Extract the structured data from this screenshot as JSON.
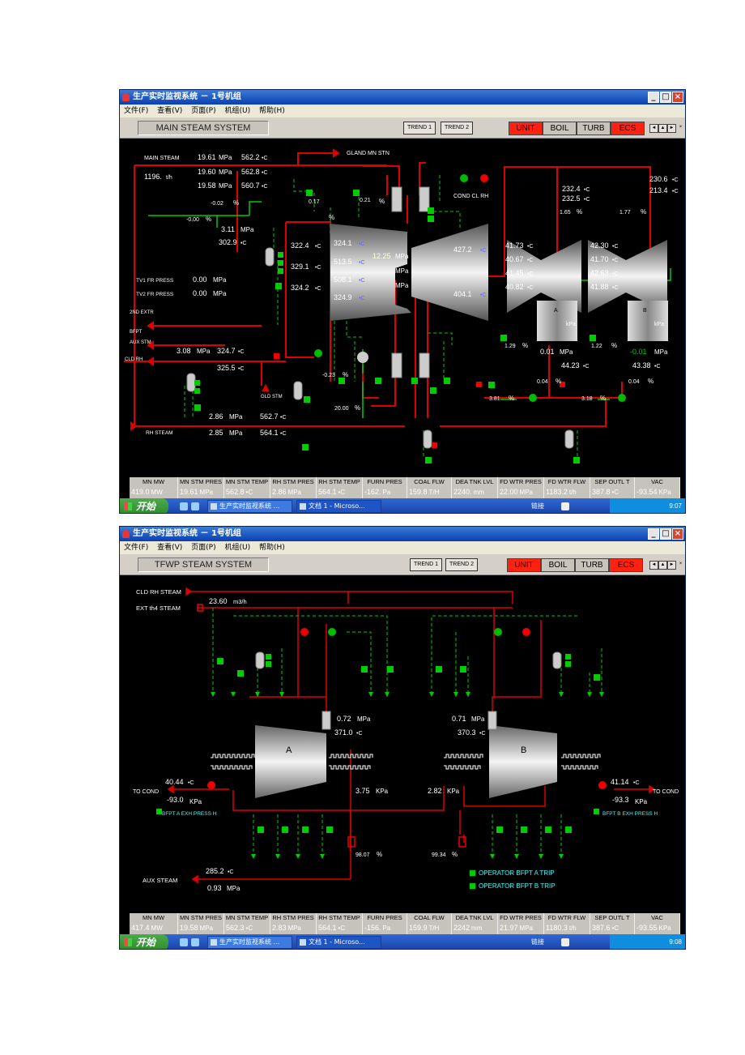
{
  "windows": [
    {
      "title": "生产实时监视系统 － 1号机组",
      "menu": [
        "文件(F)",
        "查看(V)",
        "页面(P)",
        "机组(U)",
        "帮助(H)"
      ],
      "screen_title": "MAIN STEAM SYSTEM",
      "trend_buttons": [
        "TREND 1",
        "TREND 2"
      ],
      "modes": [
        "UNIT",
        "BOIL",
        "TURB",
        "ECS"
      ],
      "labels": {
        "main_steam": "MAIN STEAM",
        "flow": "1196.",
        "flow_unit": "t/h",
        "gland": "GLAND MN STN",
        "cond_cl_rh": "COND  CL RH",
        "tv1": "TV1 FR PRESS",
        "tv2": "TV2 FR PRESS",
        "extr": "2ND EXTR",
        "bfpt": "BFPT",
        "aux_stm": "AUX STM",
        "cld_rh": "CLD RH",
        "gld_stm": "GLD STM",
        "rh_steam": "RH STEAM",
        "pump_a": "A",
        "pump_b": "B",
        "v1": "19.61",
        "v2": "562.2",
        "v3": "19.60",
        "v4": "562.8",
        "v5": "19.58",
        "v6": "560.7",
        "v7": "-0.02",
        "v8": "-0.00",
        "v9": "0.17",
        "v10": "0.21",
        "v11": "3.11",
        "v12": "302.9",
        "v13": "322.4",
        "v14": "329.1",
        "v15": "324.2",
        "v16": "324.1",
        "v17": "513.5",
        "v18": "508.1",
        "v19": "324.9",
        "v20": "12.25",
        "v21": "427.2",
        "v22": "404.1",
        "v23": "232.4",
        "v24": "232.5",
        "v25": "1.65",
        "v26": "1.77",
        "v27": "230.6",
        "v28": "213.4",
        "v29": "41.73",
        "v30": "40.67",
        "v31": "41.45",
        "v32": "40.82",
        "v33": "42.30",
        "v34": "41.70",
        "v35": "42.63",
        "v36": "41.88",
        "v37": "0.00",
        "v38": "0.00",
        "v39": "3.08",
        "v40": "324.7",
        "v41": "325.5",
        "v42": "-0.23",
        "v43": "20.00",
        "v44": "1.29",
        "v45": "0.01",
        "v46": "44.23",
        "v47": "0.04",
        "v48": "1.22",
        "v49": "-0.01",
        "v50": "43.38",
        "v51": "0.04",
        "v52": "3.81",
        "v53": "3.18",
        "v54": "2.86",
        "v55": "562.7",
        "v56": "2.85",
        "v57": "564.1",
        "unit_mpa": "MPa",
        "unit_c": "•C",
        "unit_pct": "%",
        "unit_kpa": "kPa"
      },
      "status": [
        {
          "h": "MN MW",
          "v": "419.0",
          "u": "MW"
        },
        {
          "h": "MN STM PRES",
          "v": "19.61",
          "u": "MPa"
        },
        {
          "h": "MN STM TEMP",
          "v": "562.8",
          "u": "•C"
        },
        {
          "h": "RH STM PRES",
          "v": "2.86",
          "u": "MPa"
        },
        {
          "h": "RH STM TEMP",
          "v": "564.1",
          "u": "•C"
        },
        {
          "h": "FURN PRES",
          "v": "-162.",
          "u": "Pa"
        },
        {
          "h": "COAL FLW",
          "v": "159.8",
          "u": "T/H"
        },
        {
          "h": "DEA TNK LVL",
          "v": "2240.",
          "u": "mm"
        },
        {
          "h": "FD WTR PRES",
          "v": "22.00",
          "u": "MPa"
        },
        {
          "h": "FD WTR FLW",
          "v": "1183.2",
          "u": "t/h"
        },
        {
          "h": "SEP OUTL T",
          "v": "387.8",
          "u": "•C"
        },
        {
          "h": "VAC",
          "v": "-93.54",
          "u": "KPa"
        }
      ],
      "taskbar": {
        "start": "开始",
        "tasks": [
          "生产实时监视系统 ...",
          "文档 1 - Microso..."
        ],
        "link": "链接",
        "clock": "9:07"
      }
    },
    {
      "title": "生产实时监视系统 － 1号机组",
      "menu": [
        "文件(F)",
        "查看(V)",
        "页面(P)",
        "机组(U)",
        "帮助(H)"
      ],
      "screen_title": "TFWP STEAM SYSTEM",
      "trend_buttons": [
        "TREND 1",
        "TREND 2"
      ],
      "modes": [
        "UNIT",
        "BOIL",
        "TURB",
        "ECS"
      ],
      "labels": {
        "cld_rh_steam": "CLD RH STEAM",
        "ext_steam": "EXT th4 STEAM",
        "flow": "23.60",
        "flow_unit": "m3/h",
        "turbine_a": "A",
        "turbine_b": "B",
        "a_press": "0.72",
        "a_temp": "371.0",
        "b_press": "0.71",
        "b_temp": "370.3",
        "to_cond": "TO COND",
        "a_exh_t": "40.44",
        "a_exh_p": "-93.0",
        "b_exh_t": "41.14",
        "b_exh_p": "-93.3",
        "a_kpa": "3.75",
        "b_kpa": "2.82",
        "alarm_a": "BFPT A EXH PRESS H",
        "alarm_b": "BFPT B EXH PRESS H",
        "a_valve": "98.07",
        "b_valve": "99.34",
        "aux_steam": "AUX STEAM",
        "aux_t": "285.2",
        "aux_p": "0.93",
        "trip_a": "OPERATOR BFPT A TRIP",
        "trip_b": "OPERATOR BFPT B TRIP",
        "unit_mpa": "MPa",
        "unit_c": "•C",
        "unit_pct": "%",
        "unit_kpa": "KPa"
      },
      "status": [
        {
          "h": "MN MW",
          "v": "417.4",
          "u": "MW"
        },
        {
          "h": "MN STM PRES",
          "v": "19.58",
          "u": "MPa"
        },
        {
          "h": "MN STM TEMP",
          "v": "562.3",
          "u": "•C"
        },
        {
          "h": "RH STM PRES",
          "v": "2.83",
          "u": "MPa"
        },
        {
          "h": "RH STM TEMP",
          "v": "564.1",
          "u": "•C"
        },
        {
          "h": "FURN PRES",
          "v": "-156.",
          "u": "Pa"
        },
        {
          "h": "COAL FLW",
          "v": "159.9",
          "u": "T/H"
        },
        {
          "h": "DEA TNK LVL",
          "v": "2242",
          "u": "mm"
        },
        {
          "h": "FD WTR PRES",
          "v": "21.97",
          "u": "MPa"
        },
        {
          "h": "FD WTR FLW",
          "v": "1180.3",
          "u": "t/h"
        },
        {
          "h": "SEP OUTL T",
          "v": "387.6",
          "u": "•C"
        },
        {
          "h": "VAC",
          "v": "-93.55",
          "u": "KPa"
        }
      ],
      "taskbar": {
        "start": "开始",
        "tasks": [
          "生产实时监视系统 ...",
          "文档 1 - Microso..."
        ],
        "link": "链接",
        "clock": "9:08"
      }
    }
  ]
}
